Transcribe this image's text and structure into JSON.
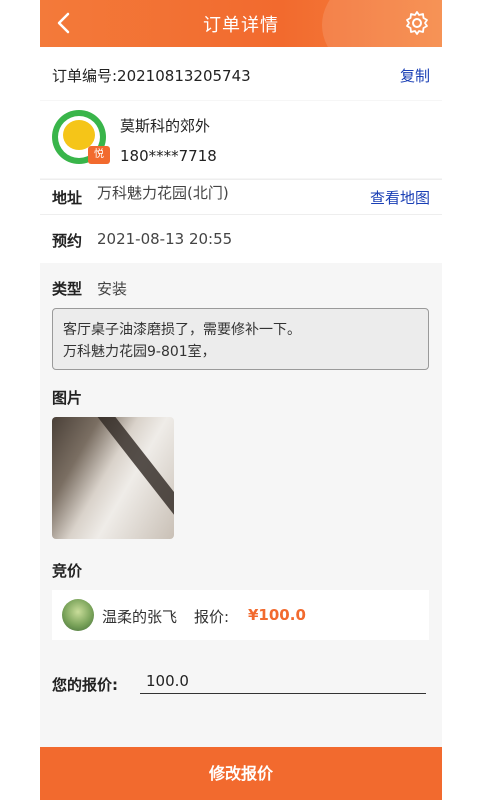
{
  "header": {
    "title": "订单详情",
    "back_icon": "chevron-left-icon",
    "settings_icon": "gear-icon"
  },
  "order": {
    "number_label": "订单编号:20210813205743",
    "copy_label": "复制"
  },
  "customer": {
    "name": "莫斯科的郊外",
    "phone": "180****7718",
    "avatar_tag": "悦"
  },
  "address": {
    "label": "地址",
    "value": "万科魅力花园(北门)",
    "map_link": "查看地图"
  },
  "appointment": {
    "label": "预约",
    "value": "2021-08-13 20:55"
  },
  "type": {
    "label": "类型",
    "value": "安装"
  },
  "description": {
    "line1": "客厅桌子油漆磨损了，需要修补一下。",
    "line2": "万科魅力花园9-801室，"
  },
  "images": {
    "label": "图片"
  },
  "bids": {
    "label": "竞价",
    "items": [
      {
        "name": "温柔的张飞",
        "price_label": "报价:",
        "price": "¥100.0"
      }
    ]
  },
  "your_bid": {
    "label": "您的报价:",
    "value": "100.0"
  },
  "footer": {
    "submit_label": "修改报价"
  },
  "colors": {
    "accent": "#f26a2e",
    "link": "#1a3fb5"
  }
}
